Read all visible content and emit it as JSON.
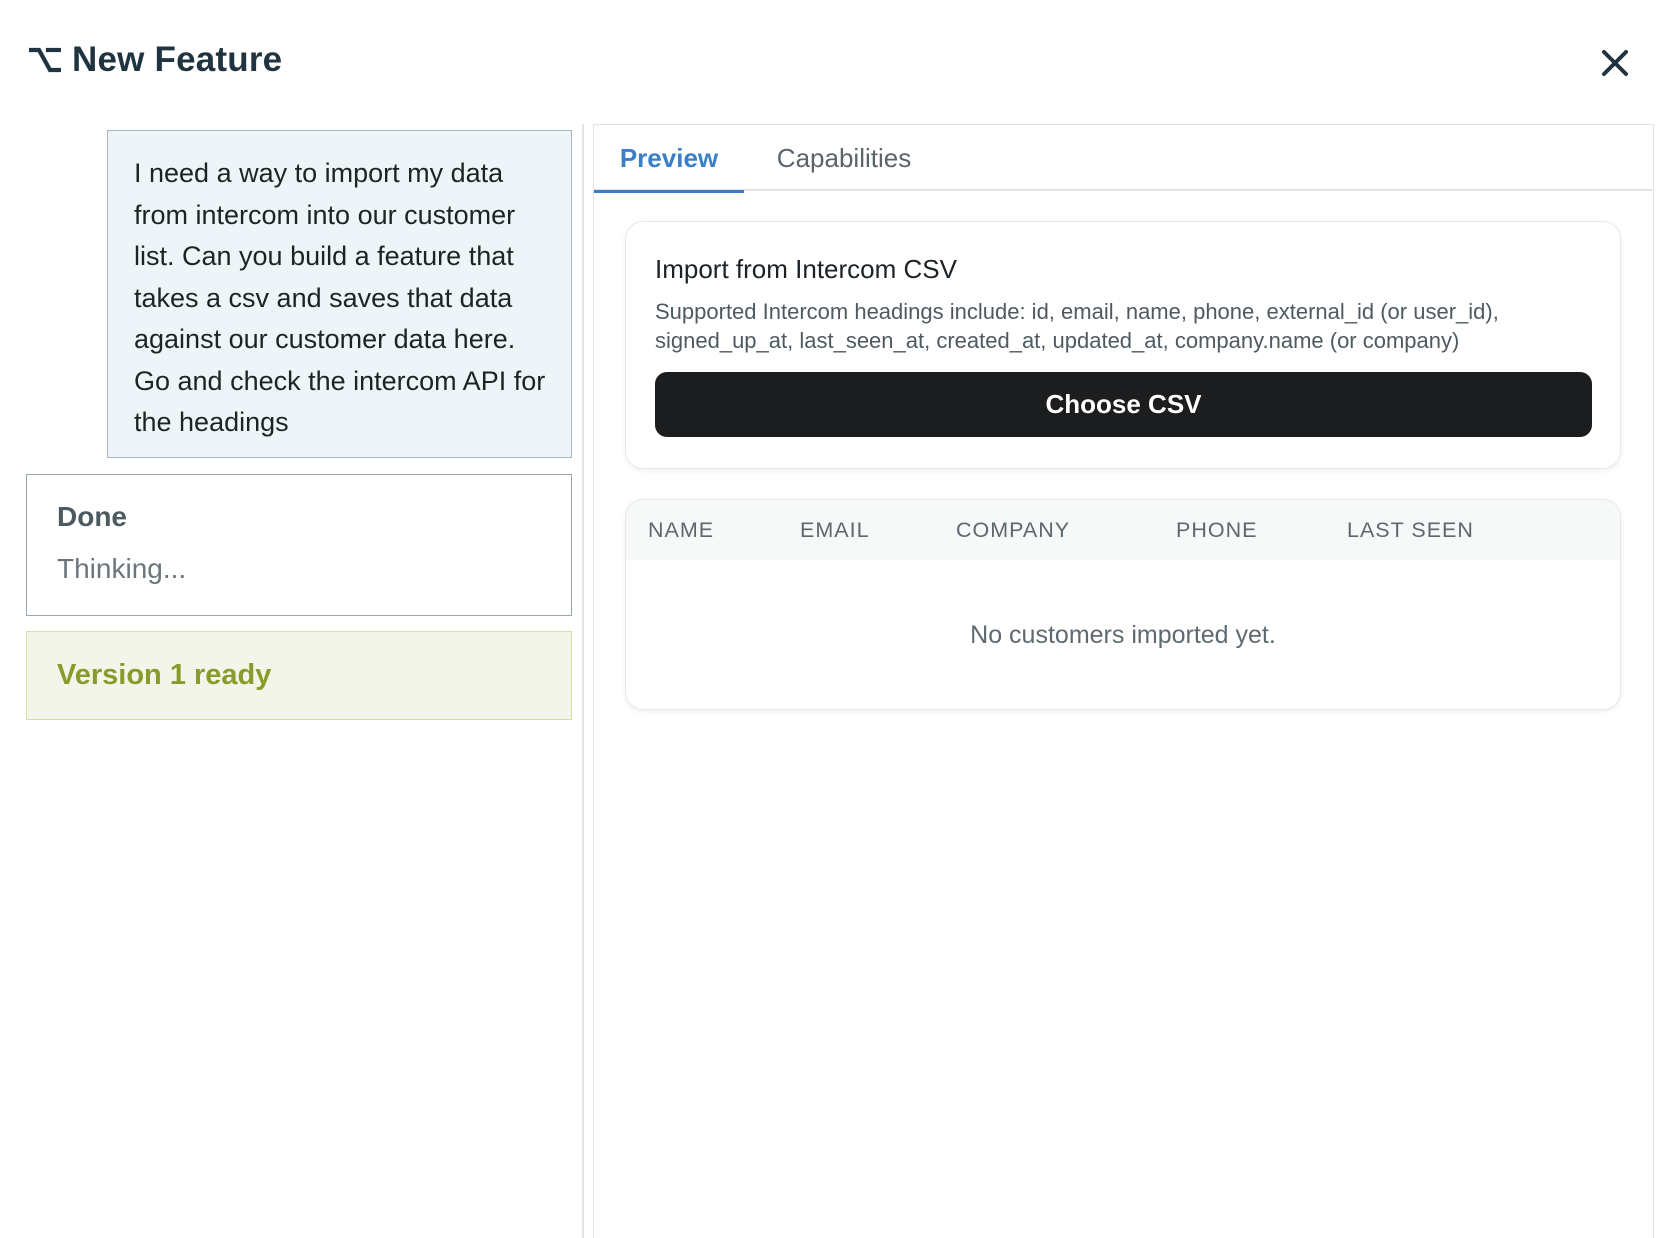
{
  "header": {
    "title": "New Feature",
    "title_icon": "option-key-icon",
    "close_icon": "close-icon"
  },
  "chat": {
    "user_message": "I need a way to import my data from intercom into our customer list. Can you build a feature that takes a csv and saves that data against our customer data here. Go and check the intercom API for the headings",
    "status": {
      "title": "Done",
      "subtitle": "Thinking..."
    },
    "version": {
      "label": "Version 1 ready"
    }
  },
  "tabs": [
    {
      "label": "Preview",
      "active": true
    },
    {
      "label": "Capabilities",
      "active": false
    }
  ],
  "import": {
    "title": "Import from Intercom CSV",
    "description": "Supported Intercom headings include: id, email, name, phone, external_id (or user_id), signed_up_at, last_seen_at, created_at, updated_at, company.name (or company)",
    "button_label": "Choose CSV"
  },
  "table": {
    "columns": [
      "NAME",
      "EMAIL",
      "COMPANY",
      "PHONE",
      "LAST SEEN"
    ],
    "empty_message": "No customers imported yet."
  },
  "colors": {
    "accent": "#3a80c9",
    "version_text": "#8a9a2c",
    "version_bg": "#f3f5e8",
    "user_msg_bg": "#eef5f8",
    "button_bg": "#1c1d1f"
  }
}
